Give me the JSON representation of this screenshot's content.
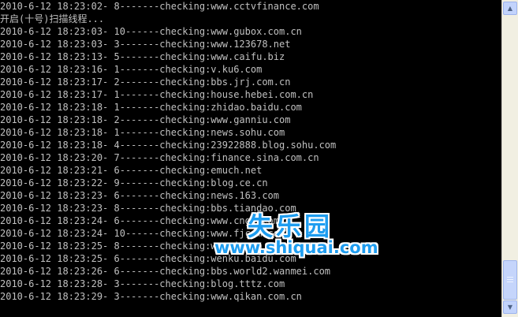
{
  "console": {
    "lines": [
      "2010-6-12 18:23:02- 8-------checking:www.cctvfinance.com",
      "开启(十号)扫描线程...",
      "2010-6-12 18:23:03- 10------checking:www.gubox.com.cn",
      "2010-6-12 18:23:03- 3-------checking:www.123678.net",
      "2010-6-12 18:23:13- 5-------checking:www.caifu.biz",
      "2010-6-12 18:23:16- 1-------checking:v.ku6.com",
      "2010-6-12 18:23:17- 2-------checking:bbs.jrj.com.cn",
      "2010-6-12 18:23:17- 1-------checking:house.hebei.com.cn",
      "2010-6-12 18:23:18- 1-------checking:zhidao.baidu.com",
      "2010-6-12 18:23:18- 2-------checking:www.ganniu.com",
      "2010-6-12 18:23:18- 1-------checking:news.sohu.com",
      "2010-6-12 18:23:18- 4-------checking:23922888.blog.sohu.com",
      "2010-6-12 18:23:20- 7-------checking:finance.sina.com.cn",
      "2010-6-12 18:23:21- 6-------checking:emuch.net",
      "2010-6-12 18:23:22- 9-------checking:blog.ce.cn",
      "2010-6-12 18:23:23- 6-------checking:news.163.com",
      "2010-6-12 18:23:23- 8-------checking:bbs.tiandao.com",
      "2010-6-12 18:23:24- 6-------checking:www.cngz.com",
      "2010-6-12 18:23:24- 10------checking:www.fjcom.com",
      "2010-6-12 18:23:25- 8-------checking:www.i.com",
      "2010-6-12 18:23:25- 6-------checking:wenku.baidu.com",
      "2010-6-12 18:23:26- 6-------checking:bbs.world2.wanmei.com",
      "2010-6-12 18:23:28- 3-------checking:blog.tttz.com",
      "2010-6-12 18:23:29- 3-------checking:www.qikan.com.cn"
    ]
  },
  "watermark": {
    "logo": "失乐园",
    "url": "www.shiquai.com"
  },
  "scrollbar": {
    "up_icon": "scroll-up-arrow-icon",
    "down_icon": "scroll-down-arrow-icon",
    "up_glyph": "▲",
    "down_glyph": "▼"
  },
  "colors": {
    "background": "#000000",
    "text": "#c0c0c0",
    "watermark": "#1e9df0"
  }
}
